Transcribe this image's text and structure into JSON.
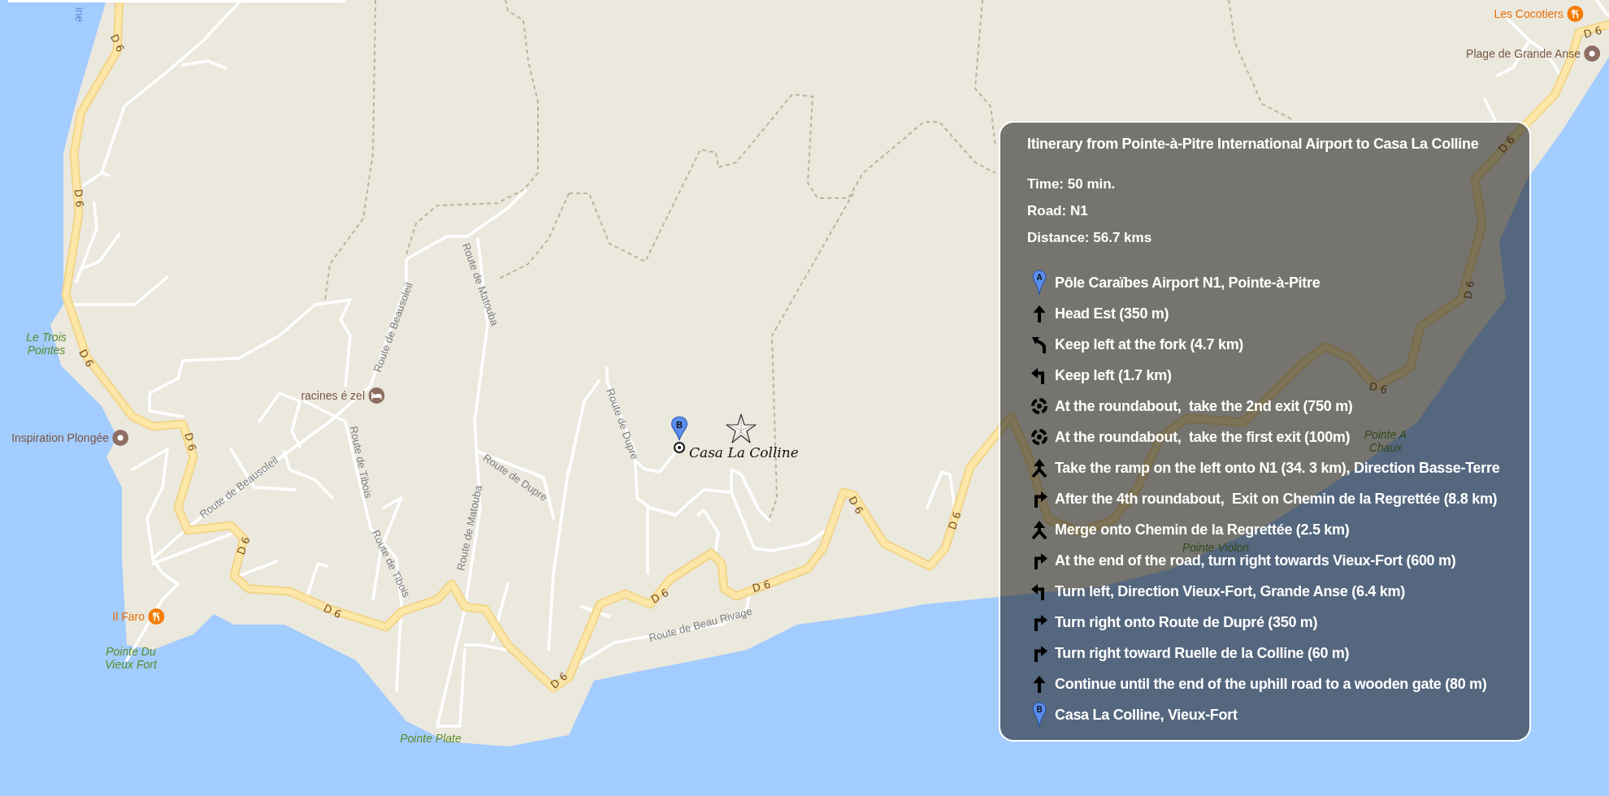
{
  "map": {
    "labels": [
      {
        "text": "Les Cocotiers",
        "kind": "restaurant"
      },
      {
        "text": "ine",
        "kind": "water"
      },
      {
        "text": "D 6",
        "kind": "highway"
      },
      {
        "text": "D 6",
        "kind": "highway"
      },
      {
        "text": "Plage de Grande Anse",
        "kind": "landmark"
      },
      {
        "text": "D 6",
        "kind": "highway"
      },
      {
        "text": "D 6",
        "kind": "highway"
      },
      {
        "text": "Route de Matouba",
        "kind": "road"
      },
      {
        "text": "D 6",
        "kind": "highway"
      },
      {
        "text": "Route de Beausoleil",
        "kind": "road"
      },
      {
        "text": "Le Trois Pointes",
        "kind": "place"
      },
      {
        "text": "D 6",
        "kind": "highway"
      },
      {
        "text": "D 6",
        "kind": "highway"
      },
      {
        "text": "racines é zel",
        "kind": "lodging"
      },
      {
        "text": "Route de Dupre",
        "kind": "road"
      },
      {
        "text": "Inspiration Plongée",
        "kind": "landmark"
      },
      {
        "text": "D 6",
        "kind": "highway"
      },
      {
        "text": "Pointe A Chaux",
        "kind": "place"
      },
      {
        "text": "Route de Tibois",
        "kind": "road"
      },
      {
        "text": "Route de Dupre",
        "kind": "road"
      },
      {
        "text": "Route de Beausoleil",
        "kind": "road"
      },
      {
        "text": "D 6",
        "kind": "highway"
      },
      {
        "text": "D 6",
        "kind": "highway"
      },
      {
        "text": "Route de Matouba",
        "kind": "road"
      },
      {
        "text": "D 6",
        "kind": "highway"
      },
      {
        "text": "Pointe Violon",
        "kind": "place"
      },
      {
        "text": "Route de Tibois",
        "kind": "road"
      },
      {
        "text": "D 6",
        "kind": "highway"
      },
      {
        "text": "D 6",
        "kind": "highway"
      },
      {
        "text": "D 6",
        "kind": "highway"
      },
      {
        "text": "Il Faro",
        "kind": "restaurant"
      },
      {
        "text": "Route de Beau Rivage",
        "kind": "road"
      },
      {
        "text": "Pointe Du Vieux Fort",
        "kind": "place"
      },
      {
        "text": "D 6",
        "kind": "highway"
      },
      {
        "text": "Pointe Plate",
        "kind": "place"
      }
    ],
    "destination": {
      "marker": "B",
      "name": "Casa La Colline"
    }
  },
  "itinerary": {
    "title": "Itinerary from Pointe-à-Pitre International Airport to Casa La Colline",
    "summary": [
      "Time: 50 min.",
      "Road: N1",
      "Distance: 56.7 kms"
    ],
    "steps": [
      {
        "kind": "start",
        "marker": "A",
        "text": "Pôle Caraïbes Airport N1, Pointe-à-Pitre"
      },
      {
        "kind": "straight",
        "text": "Head Est (350 m)"
      },
      {
        "kind": "fork-left",
        "text": "Keep left at the fork (4.7 km)"
      },
      {
        "kind": "left",
        "text": "Keep left (1.7 km)"
      },
      {
        "kind": "roundabout",
        "text": "At the roundabout,  take the 2nd exit (750 m)"
      },
      {
        "kind": "roundabout",
        "text": "At the roundabout,  take the first exit (100m)"
      },
      {
        "kind": "merge",
        "text": "Take the ramp on the left onto N1 (34. 3 km), Direction Basse-Terre"
      },
      {
        "kind": "right",
        "text": "After the 4th roundabout,  Exit on Chemin de la Regrettée (8.8 km)"
      },
      {
        "kind": "merge",
        "text": "Merge onto Chemin de la Regrettée (2.5 km)"
      },
      {
        "kind": "right",
        "text": "At the end of the road, turn right towards Vieux-Fort (600 m)"
      },
      {
        "kind": "left",
        "text": "Turn left, Direction Vieux-Fort, Grande Anse (6.4 km)"
      },
      {
        "kind": "right",
        "text": "Turn right onto Route de Dupré (350 m)"
      },
      {
        "kind": "right",
        "text": "Turn right toward Ruelle de la Colline (60 m)"
      },
      {
        "kind": "straight",
        "text": "Continue until the end of the uphill road to a wooden gate (80 m)"
      },
      {
        "kind": "end",
        "marker": "B",
        "text": "Casa La Colline, Vieux-Fort"
      }
    ]
  }
}
